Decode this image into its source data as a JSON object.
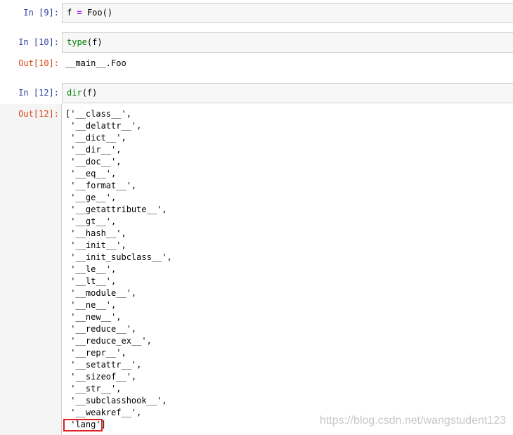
{
  "cells": [
    {
      "in_prompt": "In  [9]:",
      "code_var": "f",
      "code_op": "=",
      "code_rest": "Foo()"
    },
    {
      "in_prompt": "In  [10]:",
      "code_builtin": "type",
      "code_rest": "(f)",
      "out_prompt": "Out[10]:",
      "output": "__main__.Foo"
    },
    {
      "in_prompt": "In  [12]:",
      "code_builtin": "dir",
      "code_rest": "(f)",
      "out_prompt": "Out[12]:"
    }
  ],
  "dir_output": [
    "['__class__',",
    " '__delattr__',",
    " '__dict__',",
    " '__dir__',",
    " '__doc__',",
    " '__eq__',",
    " '__format__',",
    " '__ge__',",
    " '__getattribute__',",
    " '__gt__',",
    " '__hash__',",
    " '__init__',",
    " '__init_subclass__',",
    " '__le__',",
    " '__lt__',",
    " '__module__',",
    " '__ne__',",
    " '__new__',",
    " '__reduce__',",
    " '__reduce_ex__',",
    " '__repr__',",
    " '__setattr__',",
    " '__sizeof__',",
    " '__str__',",
    " '__subclasshook__',",
    " '__weakref__',",
    " 'lang']"
  ],
  "watermark": "https://blog.csdn.net/wangstudent123"
}
